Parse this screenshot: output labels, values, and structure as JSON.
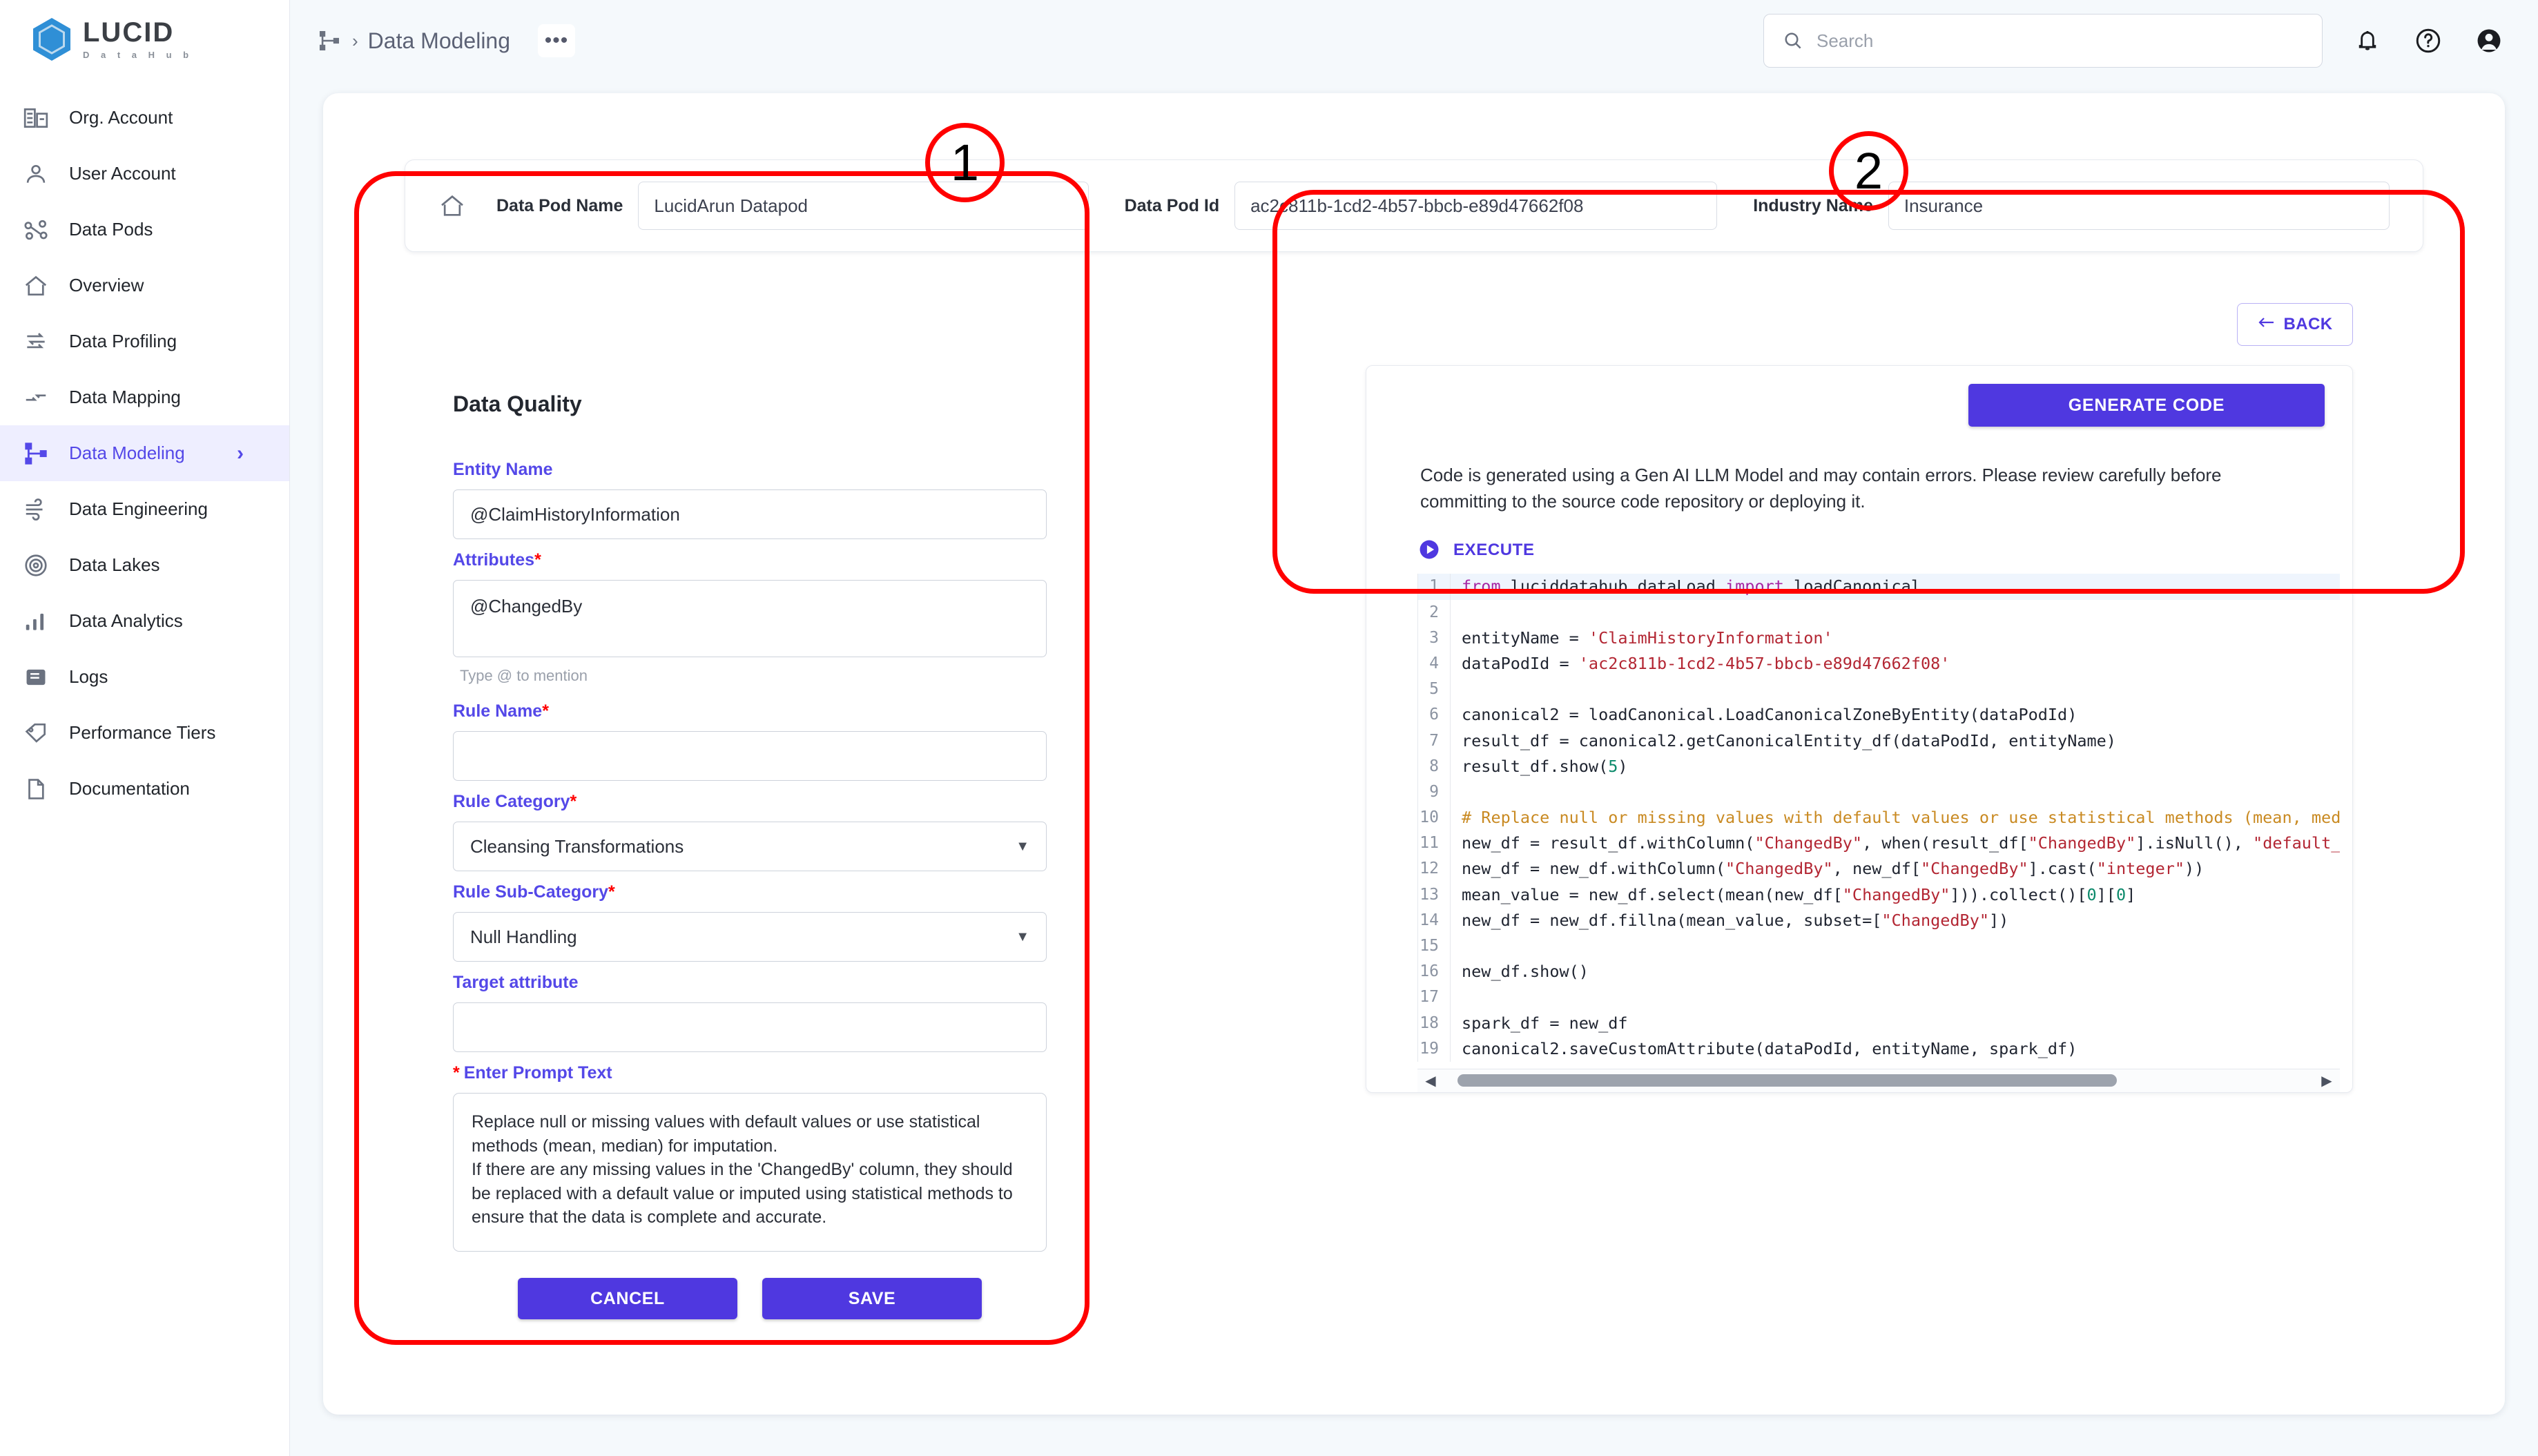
{
  "brand": {
    "name": "LUCID",
    "tagline": "D a t a   H u b",
    "logo_icon": "cube-logo-icon"
  },
  "sidebar": {
    "items": [
      {
        "label": "Org. Account",
        "icon": "building-icon",
        "active": false
      },
      {
        "label": "User Account",
        "icon": "user-icon",
        "active": false
      },
      {
        "label": "Data Pods",
        "icon": "pods-icon",
        "active": false
      },
      {
        "label": "Overview",
        "icon": "home-icon",
        "active": false
      },
      {
        "label": "Data Profiling",
        "icon": "profiling-icon",
        "active": false
      },
      {
        "label": "Data Mapping",
        "icon": "mapping-icon",
        "active": false
      },
      {
        "label": "Data Modeling",
        "icon": "modeling-icon",
        "active": true
      },
      {
        "label": "Data Engineering",
        "icon": "wind-icon",
        "active": false
      },
      {
        "label": "Data Lakes",
        "icon": "target-icon",
        "active": false
      },
      {
        "label": "Data Analytics",
        "icon": "bar-chart-icon",
        "active": false
      },
      {
        "label": "Logs",
        "icon": "logs-icon",
        "active": false
      },
      {
        "label": "Performance Tiers",
        "icon": "tag-icon",
        "active": false
      },
      {
        "label": "Documentation",
        "icon": "document-icon",
        "active": false
      }
    ]
  },
  "topbar": {
    "breadcrumb_icon": "modeling-icon",
    "breadcrumb_separator": "›",
    "breadcrumb_label": "Data Modeling",
    "more_label": "•••",
    "search": {
      "placeholder": "Search",
      "value": "",
      "icon": "search-icon"
    },
    "notification_icon": "bell-icon",
    "help_icon": "help-circle-icon",
    "account_icon": "account-avatar-icon"
  },
  "podbar": {
    "home_icon": "home-icon",
    "name_label": "Data Pod Name",
    "name_value": "LucidArun Datapod",
    "id_label": "Data Pod Id",
    "id_value": "ac2c811b-1cd2-4b57-bbcb-e89d47662f08",
    "industry_label": "Industry Name",
    "industry_value": "Insurance"
  },
  "form": {
    "title": "Data Quality",
    "entity_name": {
      "label": "Entity Name",
      "value": "@ClaimHistoryInformation"
    },
    "attributes": {
      "label": "Attributes",
      "required": "*",
      "value": "@ChangedBy",
      "hint": "Type @ to mention"
    },
    "rule_name": {
      "label": "Rule Name",
      "required": "*",
      "value": ""
    },
    "rule_category": {
      "label": "Rule Category",
      "required": "*",
      "value": "Cleansing Transformations",
      "caret": "▼"
    },
    "rule_subcategory": {
      "label": "Rule Sub-Category",
      "required": "*",
      "value": "Null Handling",
      "caret": "▼"
    },
    "target_attribute": {
      "label": "Target attribute",
      "value": ""
    },
    "prompt": {
      "required": "*",
      "label": "Enter Prompt Text",
      "value": "Replace null or missing values with default values or use statistical methods (mean, median) for imputation.\n If there are any missing values in the 'ChangedBy' column, they should be replaced with a default value or imputed using statistical methods to ensure that the data is complete and accurate."
    },
    "cancel_label": "CANCEL",
    "save_label": "SAVE"
  },
  "code_panel": {
    "back_label": "BACK",
    "back_icon": "arrow-left-icon",
    "generate_label": "GENERATE CODE",
    "disclaimer": "Code is generated using a Gen AI LLM Model and may contain errors. Please review carefully before committing to the source code repository or deploying it.",
    "execute_label": "EXECUTE",
    "execute_icon": "play-circle-icon",
    "scroll_left_icon": "◀",
    "scroll_right_icon": "▶",
    "lines": [
      {
        "n": "1",
        "html": "<span class='k-kw'>from</span> luciddatahub.dataLoad <span class='k-kw'>import</span> loadCanonical",
        "highlight": true
      },
      {
        "n": "2",
        "html": "",
        "highlight": false
      },
      {
        "n": "3",
        "html": "entityName = <span class='k-str'>'ClaimHistoryInformation'</span>",
        "highlight": false
      },
      {
        "n": "4",
        "html": "dataPodId = <span class='k-str'>'ac2c811b-1cd2-4b57-bbcb-e89d47662f08'</span>",
        "highlight": false
      },
      {
        "n": "5",
        "html": "",
        "highlight": false
      },
      {
        "n": "6",
        "html": "canonical2 = loadCanonical.LoadCanonicalZoneByEntity(dataPodId)",
        "highlight": false
      },
      {
        "n": "7",
        "html": "result_df = canonical2.getCanonicalEntity_df(dataPodId, entityName)",
        "highlight": false
      },
      {
        "n": "8",
        "html": "result_df.show(<span class='k-num'>5</span>)",
        "highlight": false
      },
      {
        "n": "9",
        "html": "",
        "highlight": false
      },
      {
        "n": "10",
        "html": "<span class='k-com'># Replace null or missing values with default values or use statistical methods (mean, median) for imp</span>",
        "highlight": false
      },
      {
        "n": "11",
        "html": "new_df = result_df.withColumn(<span class='k-str'>\"ChangedBy\"</span>, when(result_df[<span class='k-str'>\"ChangedBy\"</span>].isNull(), <span class='k-str'>\"default_value\"</span>).othe",
        "highlight": false
      },
      {
        "n": "12",
        "html": "new_df = new_df.withColumn(<span class='k-str'>\"ChangedBy\"</span>, new_df[<span class='k-str'>\"ChangedBy\"</span>].cast(<span class='k-str'>\"integer\"</span>))",
        "highlight": false
      },
      {
        "n": "13",
        "html": "mean_value = new_df.select(mean(new_df[<span class='k-str'>\"ChangedBy\"</span>])).collect()[<span class='k-num'>0</span>][<span class='k-num'>0</span>]",
        "highlight": false
      },
      {
        "n": "14",
        "html": "new_df = new_df.fillna(mean_value, subset=[<span class='k-str'>\"ChangedBy\"</span>])",
        "highlight": false
      },
      {
        "n": "15",
        "html": "",
        "highlight": false
      },
      {
        "n": "16",
        "html": "new_df.show()",
        "highlight": false
      },
      {
        "n": "17",
        "html": "",
        "highlight": false
      },
      {
        "n": "18",
        "html": "spark_df = new_df",
        "highlight": false
      },
      {
        "n": "19",
        "html": "canonical2.saveCustomAttribute(dataPodId, entityName, spark_df)",
        "highlight": false
      }
    ]
  },
  "annotations": {
    "color": "#ff0000",
    "markers": [
      {
        "label": "1"
      },
      {
        "label": "2"
      }
    ]
  }
}
